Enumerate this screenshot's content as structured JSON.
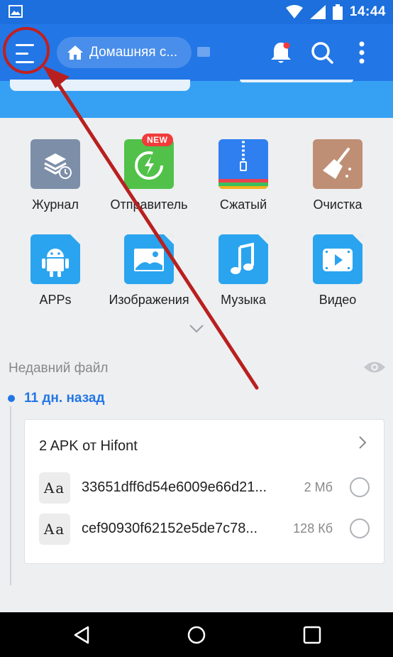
{
  "status_bar": {
    "time": "14:44"
  },
  "app_bar": {
    "breadcrumb": "Домашняя с...",
    "colors": {
      "primary": "#2276e6",
      "status": "#1c6fdc",
      "band": "#36a1f2"
    }
  },
  "categories": [
    {
      "label": "Журнал",
      "icon": "history-icon"
    },
    {
      "label": "Отправитель",
      "icon": "sender-icon",
      "badge": "NEW"
    },
    {
      "label": "Сжатый",
      "icon": "archive-icon"
    },
    {
      "label": "Очистка",
      "icon": "broom-icon"
    },
    {
      "label": "APPs",
      "icon": "android-icon"
    },
    {
      "label": "Изображения",
      "icon": "image-icon"
    },
    {
      "label": "Музыка",
      "icon": "music-note-icon"
    },
    {
      "label": "Видео",
      "icon": "video-icon"
    }
  ],
  "recent": {
    "title": "Недавний файл",
    "date": "11 дн. назад",
    "group": {
      "title": "2 APK от Hifont",
      "files": [
        {
          "icon_text": "Aa",
          "name": "33651dff6d54e6009e66d21...",
          "size": "2 Мб"
        },
        {
          "icon_text": "Aa",
          "name": "cef90930f62152e5de7c78...",
          "size": "128 Кб"
        }
      ]
    }
  }
}
